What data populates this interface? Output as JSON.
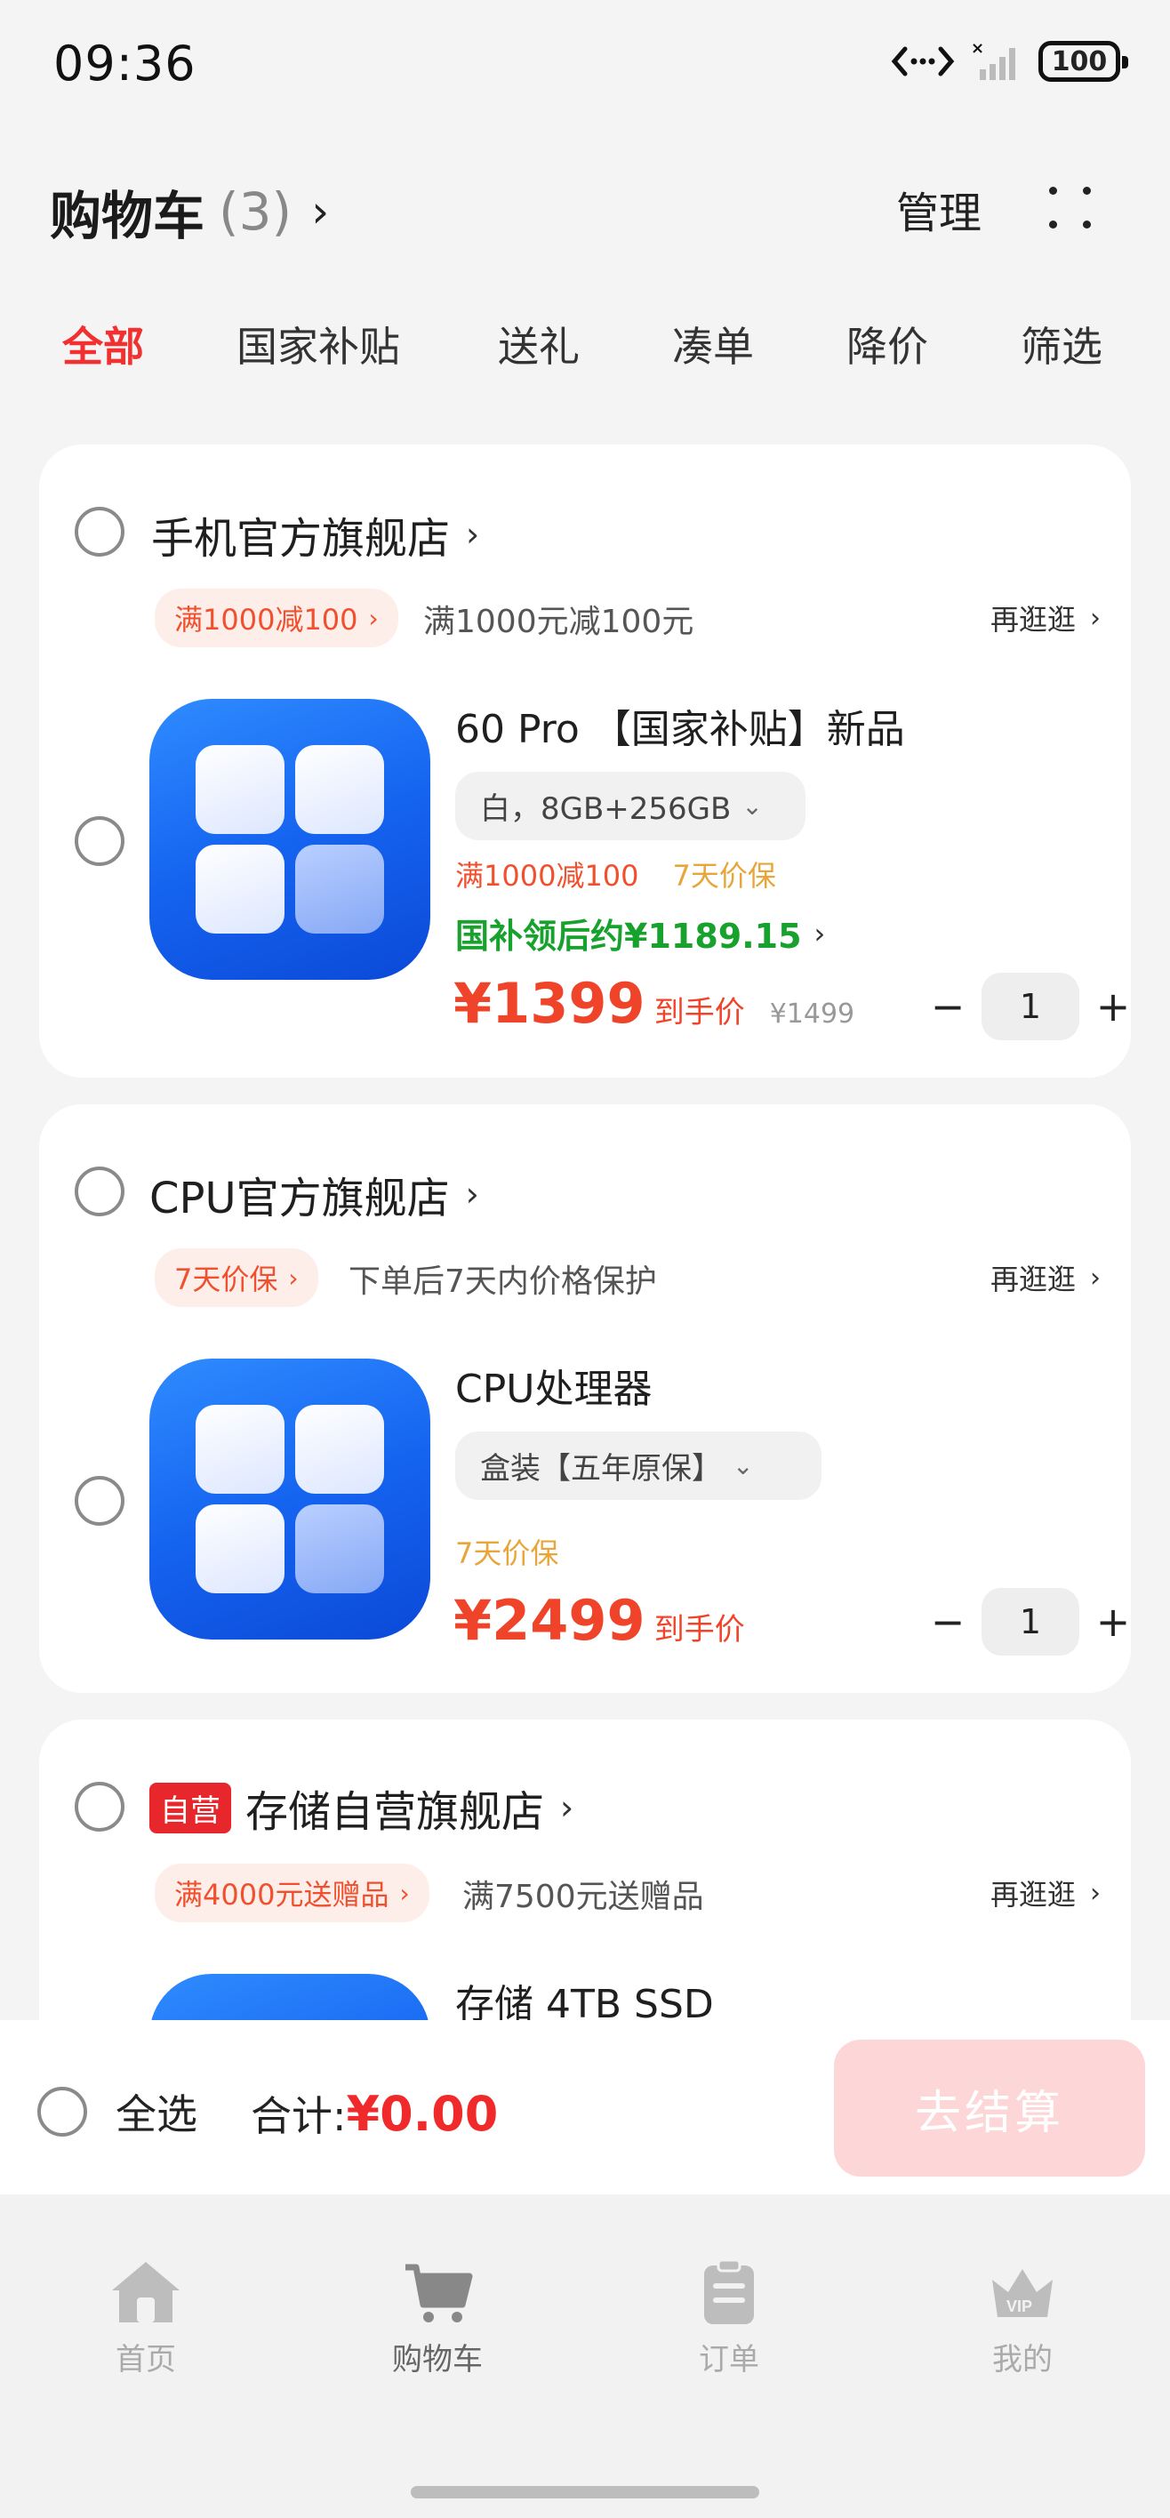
{
  "status_bar": {
    "time": "09:36",
    "battery": "100"
  },
  "header": {
    "title": "购物车",
    "count": "(3)",
    "manage": "管理"
  },
  "tabs": [
    "全部",
    "国家补贴",
    "送礼",
    "凑单",
    "降价",
    "筛选"
  ],
  "shops": [
    {
      "name": "手机官方旗舰店",
      "promo_tag": "满1000减100",
      "promo_desc": "满1000元减100元",
      "browse": "再逛逛",
      "product": {
        "name": "60 Pro 【国家补贴】新品",
        "spec": "白，8GB+256GB",
        "promo1": "满1000减100",
        "promo2": "7天价保",
        "gov_subsidy": "国补领后约¥1189.15",
        "price": "¥1399",
        "price_note": "到手价",
        "orig_price": "¥1499",
        "qty": "1"
      }
    },
    {
      "name": "CPU官方旗舰店",
      "promo_tag": "7天价保",
      "promo_desc": "下单后7天内价格保护",
      "browse": "再逛逛",
      "product": {
        "name": "CPU处理器",
        "spec": "盒装【五年原保】",
        "promo2": "7天价保",
        "price": "¥2499",
        "price_note": "到手价",
        "qty": "1"
      }
    },
    {
      "self_tag": "自营",
      "name": "存储自营旗舰店",
      "promo_tag": "满4000元送赠品",
      "promo_desc": "满7500元送赠品",
      "browse": "再逛逛",
      "product": {
        "name": "存储 4TB SSD"
      }
    }
  ],
  "checkout": {
    "select_all": "全选",
    "total_label": "合计:",
    "total_amount": "¥0.00",
    "button": "去结算"
  },
  "nav": [
    "首页",
    "购物车",
    "订单",
    "我的"
  ],
  "colors": {
    "accent_red": "#f23030",
    "price_orange": "#f0442a",
    "subsidy_green": "#17a12d",
    "checkout_disabled": "#fdd7d7"
  }
}
